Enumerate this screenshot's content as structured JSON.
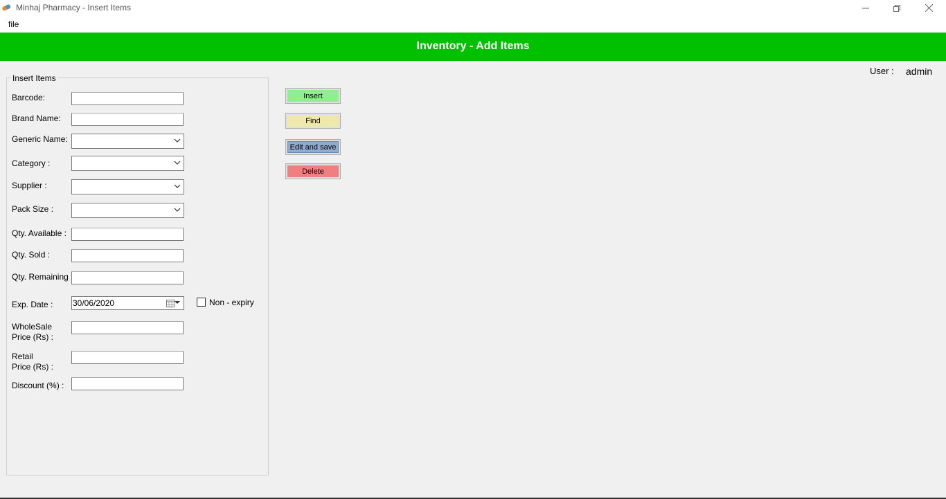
{
  "window": {
    "title": "Minhaj Pharmacy - Insert Items"
  },
  "menu": {
    "file": "file"
  },
  "header": {
    "title": "Inventory - Add Items"
  },
  "user": {
    "label": "User :",
    "value": "admin"
  },
  "form": {
    "group_title": "Insert Items",
    "barcode": {
      "label": "Barcode:",
      "value": ""
    },
    "brand_name": {
      "label": "Brand Name:",
      "value": ""
    },
    "generic_name": {
      "label": "Generic Name:",
      "value": ""
    },
    "category": {
      "label": "Category :",
      "value": ""
    },
    "supplier": {
      "label": "Supplier :",
      "value": ""
    },
    "pack_size": {
      "label": "Pack Size :",
      "value": ""
    },
    "qty_available": {
      "label": "Qty. Available :",
      "value": ""
    },
    "qty_sold": {
      "label": "Qty. Sold :",
      "value": ""
    },
    "qty_remaining": {
      "label": "Qty. Remaining",
      "value": ""
    },
    "exp_date": {
      "label": "Exp. Date :",
      "value": "30/06/2020"
    },
    "non_expiry": {
      "label": "Non - expiry",
      "checked": false
    },
    "wholesale_price": {
      "label_line1": "WholeSale",
      "label_line2": "Price (Rs)  :",
      "value": ""
    },
    "retail_price": {
      "label_line1": "Retail",
      "label_line2": "Price (Rs)  :",
      "value": ""
    },
    "discount": {
      "label": "Discount (%)  :",
      "value": ""
    }
  },
  "buttons": {
    "insert": "Insert",
    "find": "Find",
    "edit_save": "Edit and save",
    "delete": "Delete"
  },
  "colors": {
    "header": "#00c000",
    "insert": "#90ee90",
    "find": "#eee8aa",
    "edit_save": "#8eaacc",
    "delete": "#f08080"
  }
}
